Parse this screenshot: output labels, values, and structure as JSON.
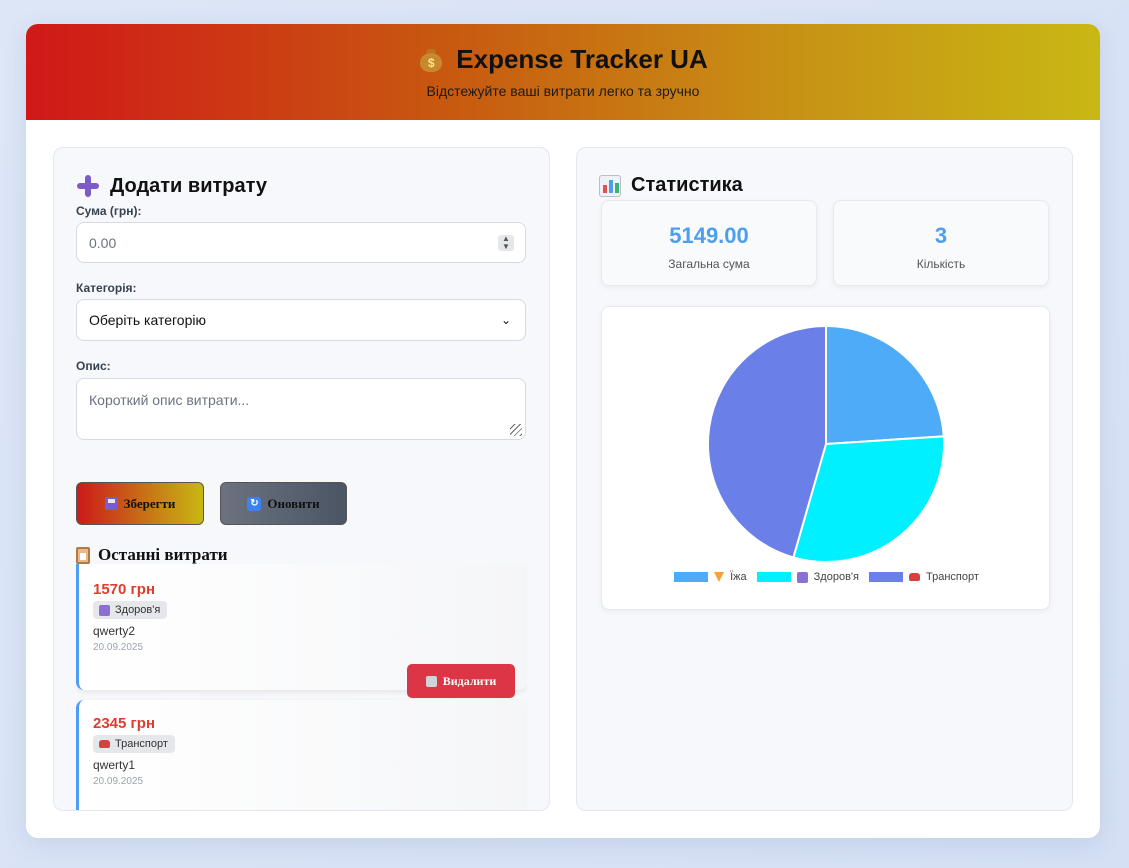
{
  "header": {
    "title": "Expense Tracker UA",
    "subtitle": "Відстежуйте ваші витрати легко та зручно"
  },
  "form": {
    "title": "Додати витрату",
    "amount_label": "Сума (грн):",
    "amount_placeholder": "0.00",
    "category_label": "Категорія:",
    "category_selected": "Оберіть категорію",
    "desc_label": "Опис:",
    "desc_placeholder": "Короткий опис витрати...",
    "save_label": "Зберегти",
    "refresh_label": "Оновити"
  },
  "recent": {
    "title": "Останні витрати",
    "items": [
      {
        "amount": "1570 грн",
        "category": "Здоров'я",
        "description": "qwerty2",
        "date": "20.09.2025",
        "delete_label": "Видалити"
      },
      {
        "amount": "2345 грн",
        "category": "Транспорт",
        "description": "qwerty1",
        "date": "20.09.2025"
      }
    ]
  },
  "stats": {
    "title": "Статистика",
    "total_value": "5149.00",
    "total_label": "Загальна сума",
    "count_value": "3",
    "count_label": "Кількість"
  },
  "chart_data": {
    "type": "pie",
    "categories": [
      "Їжа",
      "Здоров'я",
      "Транспорт"
    ],
    "values": [
      1234,
      1570,
      2345
    ],
    "colors": [
      "#4dabf7",
      "#00f0ff",
      "#6b7fe8"
    ],
    "legend_position": "bottom"
  },
  "colors": {
    "accent": "#4c9ef0",
    "amount": "#dc3e2e",
    "delete": "#dc3545"
  }
}
